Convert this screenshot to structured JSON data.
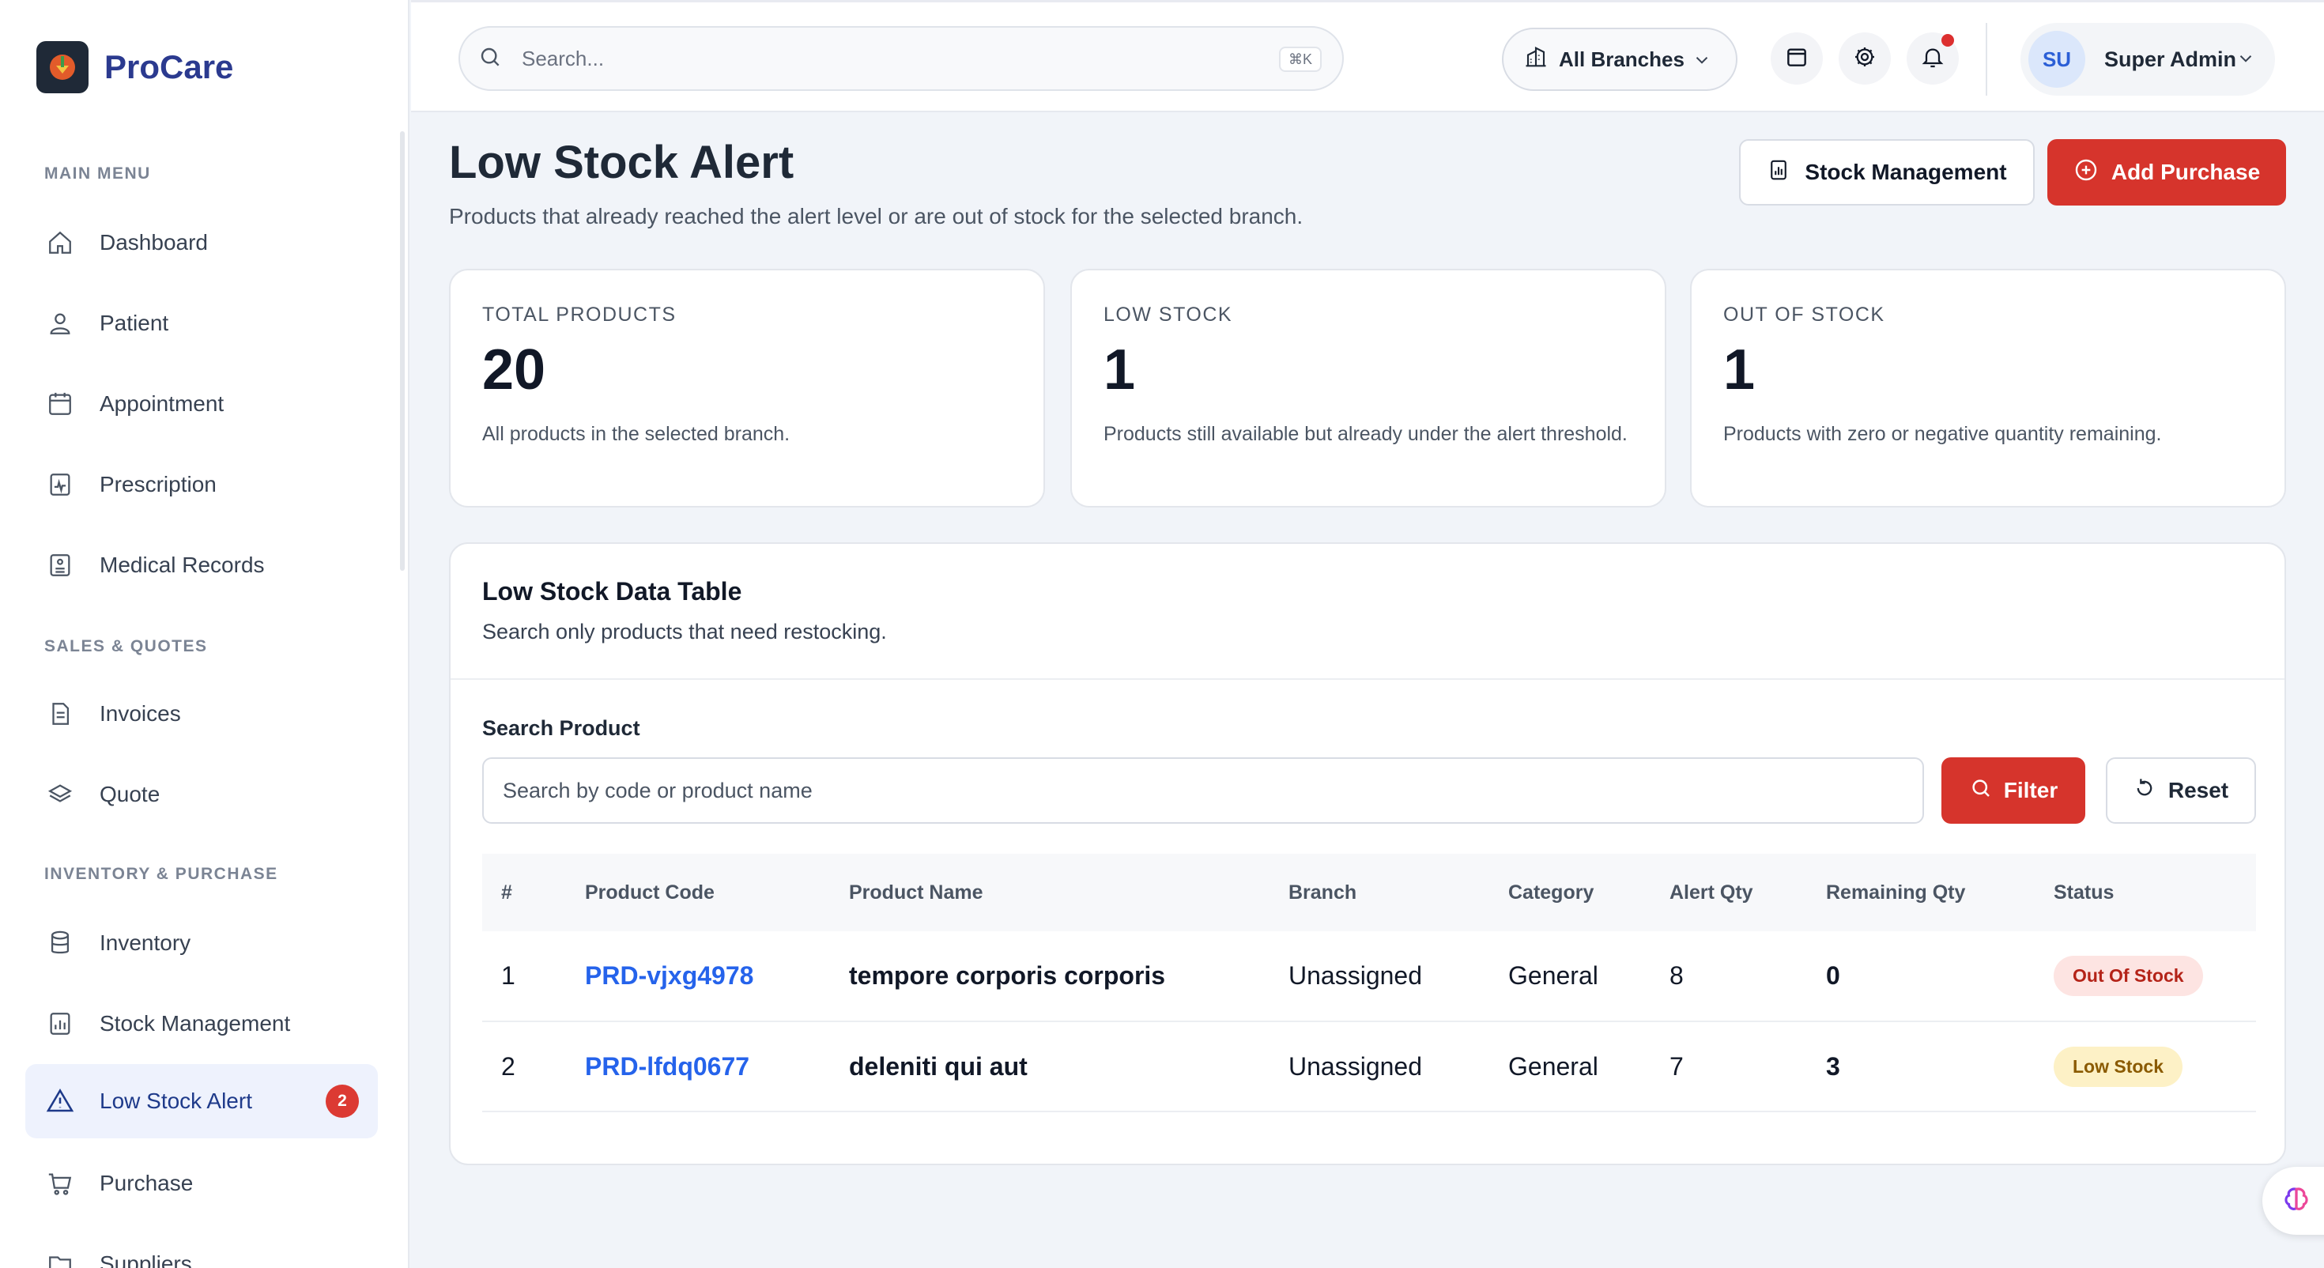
{
  "brand": {
    "name": "ProCare"
  },
  "sidebar": {
    "sections": [
      {
        "title": "MAIN MENU"
      },
      {
        "title": "SALES & QUOTES"
      },
      {
        "title": "INVENTORY & PURCHASE"
      }
    ],
    "items": [
      {
        "label": "Dashboard",
        "icon": "home-icon"
      },
      {
        "label": "Patient",
        "icon": "user-icon"
      },
      {
        "label": "Appointment",
        "icon": "calendar-icon"
      },
      {
        "label": "Prescription",
        "icon": "prescription-icon"
      },
      {
        "label": "Medical Records",
        "icon": "records-icon"
      },
      {
        "label": "Invoices",
        "icon": "invoice-icon"
      },
      {
        "label": "Quote",
        "icon": "layers-icon"
      },
      {
        "label": "Inventory",
        "icon": "database-icon"
      },
      {
        "label": "Stock Management",
        "icon": "chart-icon"
      },
      {
        "label": "Low Stock Alert",
        "icon": "warning-icon",
        "badge": "2",
        "active": true
      },
      {
        "label": "Purchase",
        "icon": "cart-icon"
      },
      {
        "label": "Suppliers",
        "icon": "folder-icon"
      }
    ]
  },
  "topbar": {
    "search_placeholder": "Search...",
    "shortcut": "⌘K",
    "branch": "All Branches",
    "user": {
      "initials": "SU",
      "name": "Super Admin"
    }
  },
  "page": {
    "title": "Low Stock Alert",
    "subtitle": "Products that already reached the alert level or are out of stock for the selected branch.",
    "stock_button": "Stock Management",
    "add_button": "Add Purchase"
  },
  "stats": [
    {
      "label": "TOTAL PRODUCTS",
      "value": "20",
      "desc": "All products in the selected branch."
    },
    {
      "label": "LOW STOCK",
      "value": "1",
      "desc": "Products still available but already under the alert threshold."
    },
    {
      "label": "OUT OF STOCK",
      "value": "1",
      "desc": "Products with zero or negative quantity remaining."
    }
  ],
  "table_card": {
    "title": "Low Stock Data Table",
    "subtitle": "Search only products that need restocking.",
    "search_label": "Search Product",
    "search_placeholder": "Search by code or product name",
    "filter_label": "Filter",
    "reset_label": "Reset",
    "columns": [
      "#",
      "Product Code",
      "Product Name",
      "Branch",
      "Category",
      "Alert Qty",
      "Remaining Qty",
      "Status"
    ],
    "rows": [
      {
        "num": "1",
        "code": "PRD-vjxg4978",
        "name": "tempore corporis corporis",
        "branch": "Unassigned",
        "category": "General",
        "alert": "8",
        "remaining": "0",
        "status": "Out Of Stock"
      },
      {
        "num": "2",
        "code": "PRD-lfdq0677",
        "name": "deleniti qui aut",
        "branch": "Unassigned",
        "category": "General",
        "alert": "7",
        "remaining": "3",
        "status": "Low Stock"
      }
    ]
  },
  "colors": {
    "accent": "#d6342c",
    "brand": "#2b3a8f",
    "link": "#2563eb"
  }
}
